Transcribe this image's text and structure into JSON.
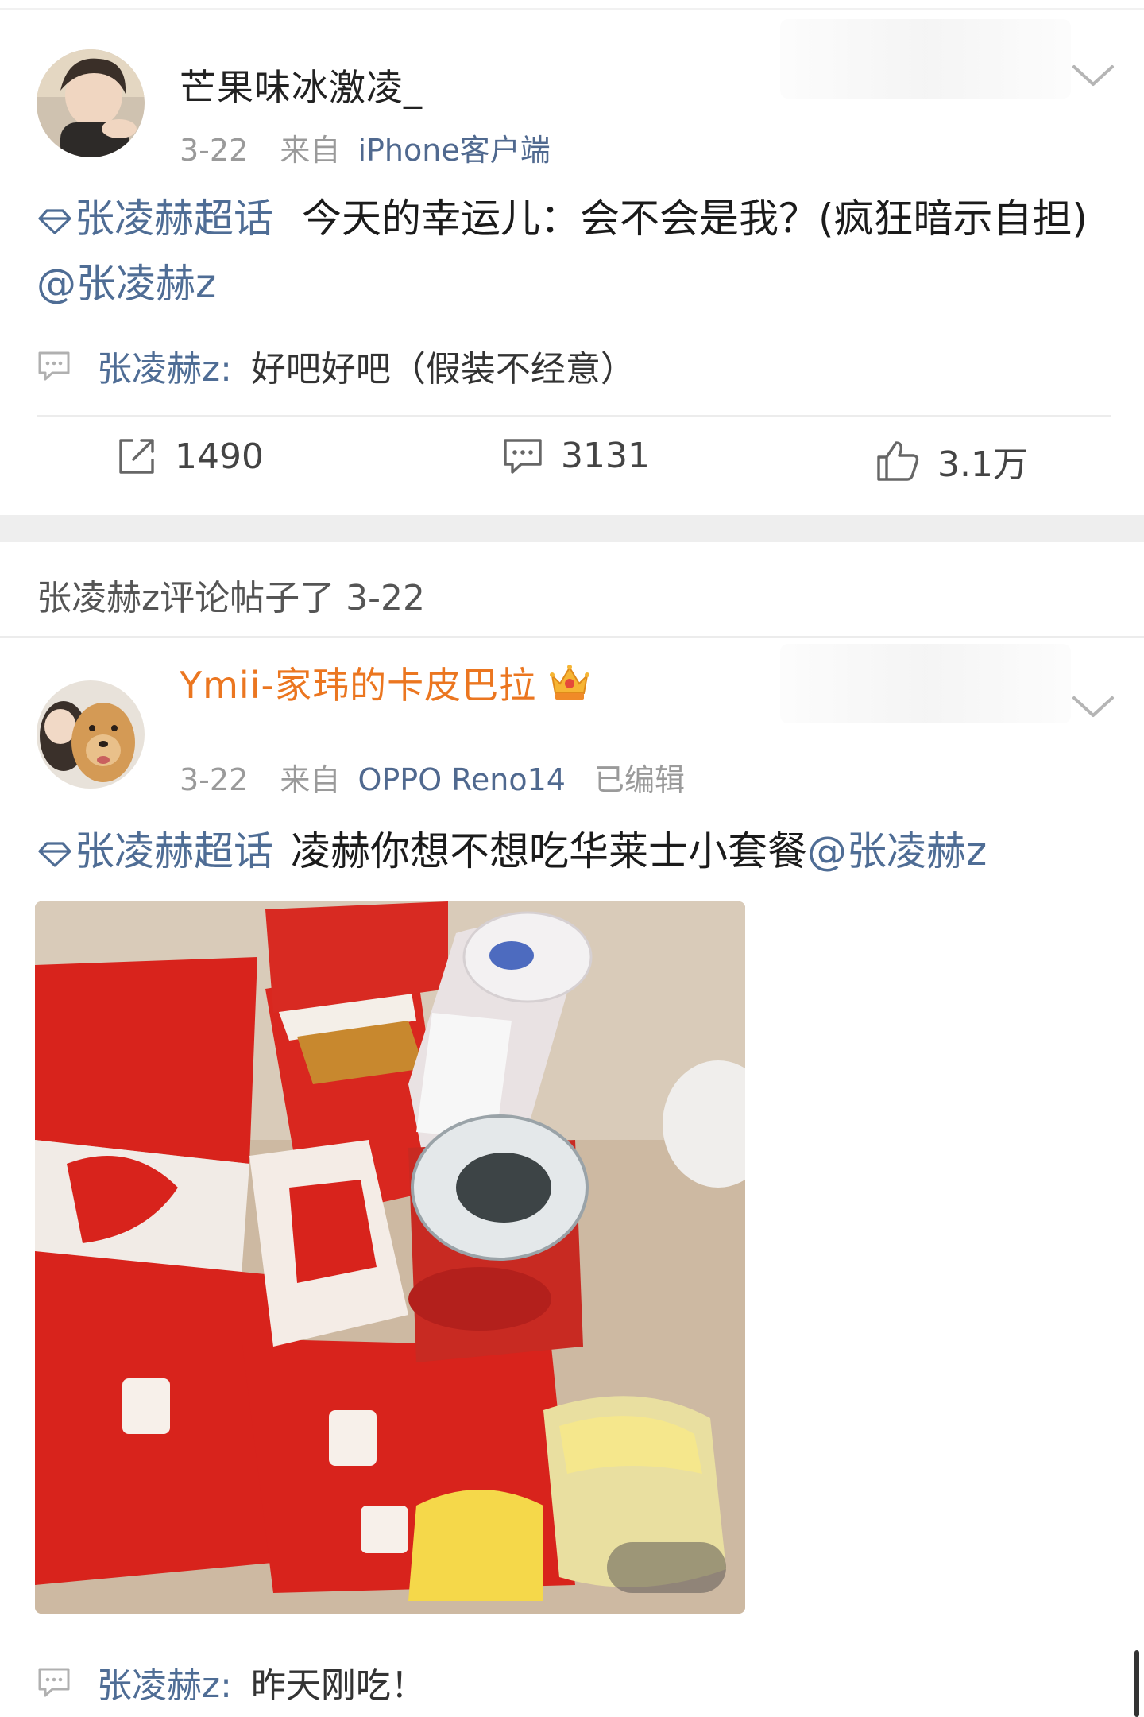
{
  "post1": {
    "username": "芒果味冰激凌_",
    "date": "3-22",
    "from_label": "来自",
    "source": "iPhone客户端",
    "topic": "张凌赫超话",
    "text": "今天的幸运儿：会不会是我？(疯狂暗示自担)",
    "mention": "@张凌赫z",
    "comment": {
      "name": "张凌赫z:",
      "text": "好吧好吧（假装不经意）"
    },
    "actions": {
      "repost": "1490",
      "comments": "3131",
      "likes": "3.1万"
    }
  },
  "notice": {
    "text": "张凌赫z评论帖子了 3-22"
  },
  "post2": {
    "username": "Ymii-家玮的卡皮巴拉",
    "date": "3-22",
    "from_label": "来自",
    "source": "OPPO Reno14",
    "edited": "已编辑",
    "topic": "张凌赫超话",
    "text": "凌赫你想不想吃华莱士小套餐",
    "mention": "@张凌赫z",
    "comment": {
      "name": "张凌赫z:",
      "text": "昨天刚吃！"
    }
  },
  "colors": {
    "link_blue": "#4f6d95",
    "vip_orange": "#eb7620",
    "meta_gray": "#9a9a9a",
    "wallace_red": "#d8231c"
  },
  "icons": [
    "chevron-down-icon",
    "topic-diamond-icon",
    "comment-bubble-icon",
    "repost-icon",
    "like-icon",
    "crown-icon"
  ]
}
